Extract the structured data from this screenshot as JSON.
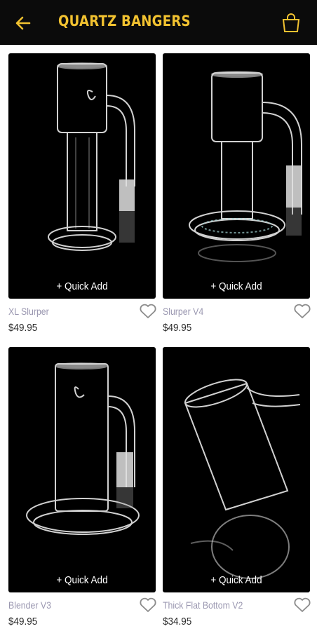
{
  "header": {
    "title": "QUARTZ BANGERS",
    "back_icon": "back-arrow-icon",
    "cart_icon": "shopping-bag-icon",
    "background": "#0b0b0b",
    "accent": "#f2c230"
  },
  "products": [
    {
      "name": "XL Slurper",
      "price": "$49.95",
      "quick_add": "+ Quick Add",
      "favorite_icon": "heart-outline-icon"
    },
    {
      "name": "Slurper V4",
      "price": "$49.95",
      "quick_add": "+ Quick Add",
      "favorite_icon": "heart-outline-icon"
    },
    {
      "name": "Blender V3",
      "price": "$49.95",
      "quick_add": "+ Quick Add",
      "favorite_icon": "heart-outline-icon"
    },
    {
      "name": "Thick Flat Bottom V2",
      "price": "$34.95",
      "quick_add": "+ Quick Add",
      "favorite_icon": "heart-outline-icon"
    }
  ]
}
